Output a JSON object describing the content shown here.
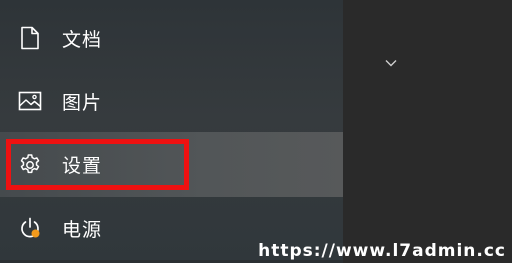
{
  "menu": {
    "items": [
      {
        "label": "文档",
        "icon": "document-icon"
      },
      {
        "label": "图片",
        "icon": "picture-icon"
      },
      {
        "label": "设置",
        "icon": "gear-icon",
        "highlighted": true
      },
      {
        "label": "电源",
        "icon": "power-icon"
      }
    ]
  },
  "right_pane": {
    "icon": "chevron-down-icon"
  },
  "annotation": {
    "color": "#ee1111"
  },
  "watermark": {
    "text": "https://www.l7admin.cc"
  },
  "colors": {
    "accent_badge": "#f29a1c"
  }
}
